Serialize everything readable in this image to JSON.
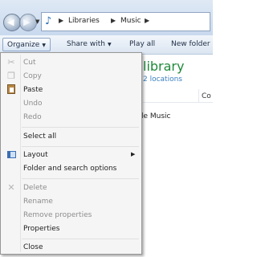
{
  "address": {
    "breadcrumbs": [
      "Libraries",
      "Music"
    ]
  },
  "toolbar": {
    "organize_label": "Organize",
    "share_label": "Share with",
    "play_label": "Play all",
    "new_folder_label": "New folder"
  },
  "library": {
    "title": "library",
    "subtitle": "2 locations",
    "column_fragment": "Co",
    "item_fragment": "le Music"
  },
  "menu": {
    "items": [
      {
        "label": "Cut",
        "enabled": false,
        "icon": "scissors-icon"
      },
      {
        "label": "Copy",
        "enabled": false,
        "icon": "copy-icon"
      },
      {
        "label": "Paste",
        "enabled": true,
        "icon": "paste-icon"
      },
      {
        "label": "Undo",
        "enabled": false
      },
      {
        "label": "Redo",
        "enabled": false
      },
      {
        "label": "Select all",
        "enabled": true
      },
      {
        "label": "Layout",
        "enabled": true,
        "icon": "layout-icon",
        "submenu": true
      },
      {
        "label": "Folder and search options",
        "enabled": true
      },
      {
        "label": "Delete",
        "enabled": false,
        "icon": "delete-x-icon"
      },
      {
        "label": "Rename",
        "enabled": false
      },
      {
        "label": "Remove properties",
        "enabled": false
      },
      {
        "label": "Properties",
        "enabled": true
      },
      {
        "label": "Close",
        "enabled": true
      }
    ]
  },
  "colors": {
    "accent_green": "#1f8a3a",
    "link_blue": "#3a7fc0",
    "disabled_text": "#8d8d8d"
  }
}
